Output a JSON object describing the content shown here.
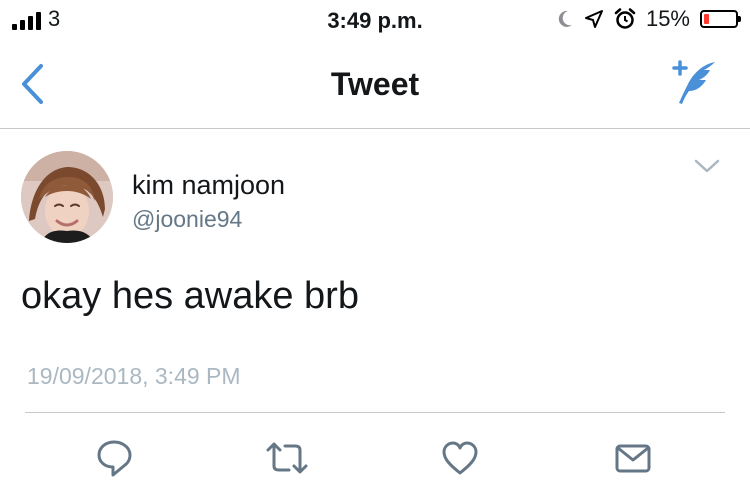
{
  "status_bar": {
    "carrier": "3",
    "time": "3:49 p.m.",
    "battery_percent_label": "15%",
    "battery_level": 0.15,
    "icons": [
      "cellular-signal-icon",
      "moon-icon",
      "location-arrow-icon",
      "alarm-clock-icon",
      "battery-icon"
    ]
  },
  "nav": {
    "title": "Tweet",
    "back_icon": "chevron-left-icon",
    "compose_icon": "compose-tweet-icon"
  },
  "tweet": {
    "display_name": "kim namjoon",
    "username": "@joonie94",
    "text": "okay hes awake brb",
    "timestamp": "19/09/2018, 3:49 PM"
  },
  "actions": [
    "reply-icon",
    "retweet-icon",
    "like-icon",
    "share-icon"
  ],
  "colors": {
    "accent": "#4a90d9",
    "secondary_text": "#657786",
    "timestamp_text": "#aab8c2",
    "icon_gray": "#657786",
    "battery_low": "#ff3b30"
  }
}
